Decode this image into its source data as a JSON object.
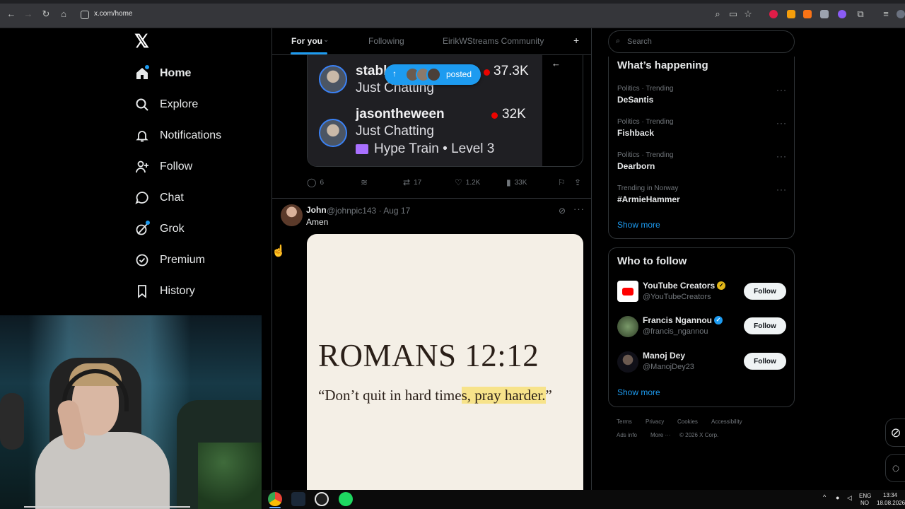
{
  "browser": {
    "url": "x.com/home"
  },
  "nav": {
    "items": [
      {
        "label": "Home",
        "icon": "home-icon"
      },
      {
        "label": "Explore",
        "icon": "search-icon"
      },
      {
        "label": "Notifications",
        "icon": "bell-icon"
      },
      {
        "label": "Follow",
        "icon": "person-add-icon"
      },
      {
        "label": "Chat",
        "icon": "chat-bubble-icon"
      },
      {
        "label": "Grok",
        "icon": "grok-icon"
      },
      {
        "label": "Premium",
        "icon": "premium-check-icon"
      },
      {
        "label": "History",
        "icon": "bookmark-icon"
      }
    ]
  },
  "feed": {
    "tabs": [
      "For you",
      "Following",
      "EirikWStreams Community"
    ],
    "add_tab": "+",
    "embed": {
      "streams": [
        {
          "name": "stabl",
          "category": "Just Chatting",
          "viewers": "37.3K"
        },
        {
          "name": "jasontheween",
          "category": "Just Chatting",
          "viewers": "32K",
          "extra": "Hype Train • Level 3"
        }
      ]
    },
    "posted_pill": {
      "label": "posted"
    },
    "actions": {
      "replies": "6",
      "reposts": "17",
      "likes": "1.2K",
      "views": "33K"
    },
    "post": {
      "name": "John",
      "handle": "@johnpic143 · Aug 17",
      "text": "Amen",
      "image": {
        "title": "ROMANS 12:12",
        "quote_plain": "“Don’t quit in hard time",
        "quote_highlight": "s, pray harder.",
        "quote_end": "”"
      }
    }
  },
  "search": {
    "placeholder": "Search"
  },
  "happening": {
    "title": "What’s happening",
    "trends": [
      {
        "meta": "Politics · Trending",
        "name": "DeSantis"
      },
      {
        "meta": "Politics · Trending",
        "name": "Fishback"
      },
      {
        "meta": "Politics · Trending",
        "name": "Dearborn"
      },
      {
        "meta": "Trending in Norway",
        "name": "#ArmieHammer"
      }
    ],
    "show_more": "Show more"
  },
  "who_to_follow": {
    "title": "Who to follow",
    "accounts": [
      {
        "name": "YouTube Creators",
        "handle": "@YouTubeCreators",
        "badge_color": "#e2b719",
        "button": "Follow"
      },
      {
        "name": "Francis Ngannou",
        "handle": "@francis_ngannou",
        "badge_color": "#1d9bf0",
        "button": "Follow"
      },
      {
        "name": "Manoj Dey",
        "handle": "@ManojDey23",
        "badge_color": "",
        "button": "Follow"
      }
    ],
    "show_more": "Show more"
  },
  "footer": {
    "links": [
      "Terms",
      "Privacy",
      "Cookies",
      "Accessibility",
      "Ads info",
      "More ···",
      "© 2026 X Corp."
    ]
  },
  "taskbar": {
    "lang_top": "ENG",
    "lang_bottom": "NO",
    "time": "13:34",
    "date": "18.08.2026"
  },
  "colors": {
    "accent": "#1d9bf0",
    "live": "#eb0400",
    "highlight": "#f7e38a"
  }
}
